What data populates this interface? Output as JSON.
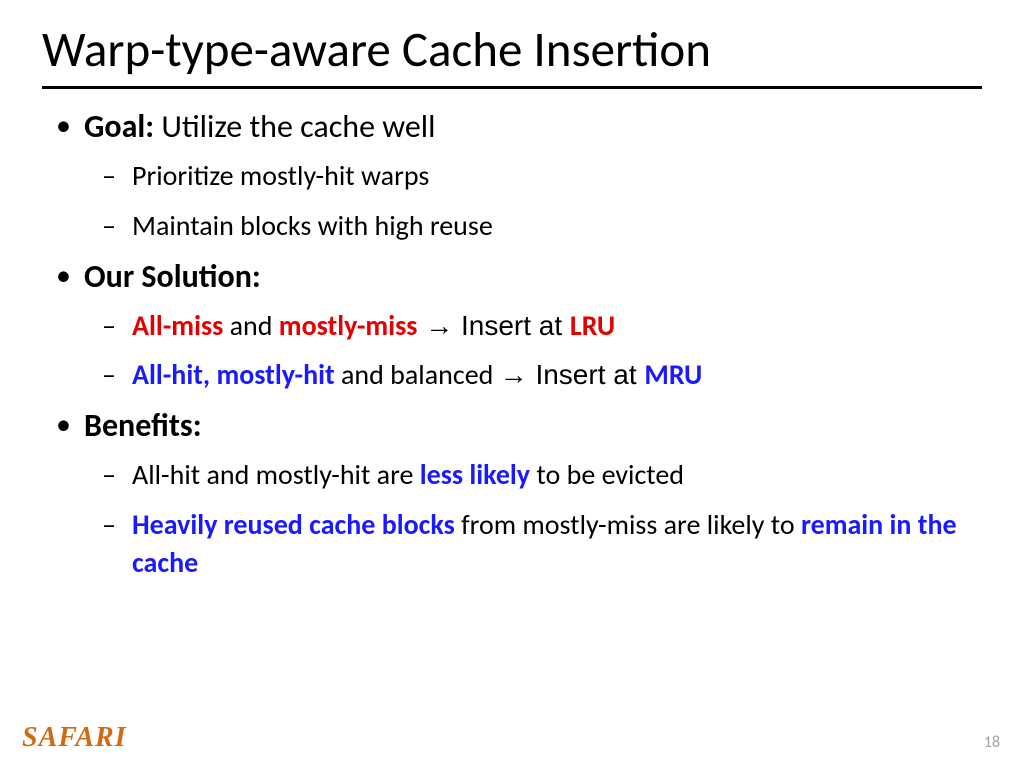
{
  "title": "Warp-type-aware Cache Insertion",
  "goal": {
    "label": "Goal:",
    "text": " Utilize the cache well",
    "sub1": "Prioritize mostly-hit warps",
    "sub2": "Maintain blocks with high reuse"
  },
  "solution": {
    "label": "Our Solution:",
    "line1": {
      "a": "All-miss",
      "b": " and ",
      "c": "mostly-miss",
      "d": " → Insert at ",
      "e": "LRU"
    },
    "line2": {
      "a": "All-hit, mostly-hit",
      "b": " and balanced ",
      "c": "→ Insert at ",
      "d": "MRU"
    }
  },
  "benefits": {
    "label": "Benefits:",
    "line1": {
      "a": "All-hit and mostly-hit are ",
      "b": "less likely",
      "c": " to be evicted"
    },
    "line2": {
      "a": "Heavily reused cache blocks",
      "b": " from mostly-miss are likely to ",
      "c": "remain in the cache"
    }
  },
  "footer": {
    "logo": "SAFARI",
    "page": "18"
  }
}
